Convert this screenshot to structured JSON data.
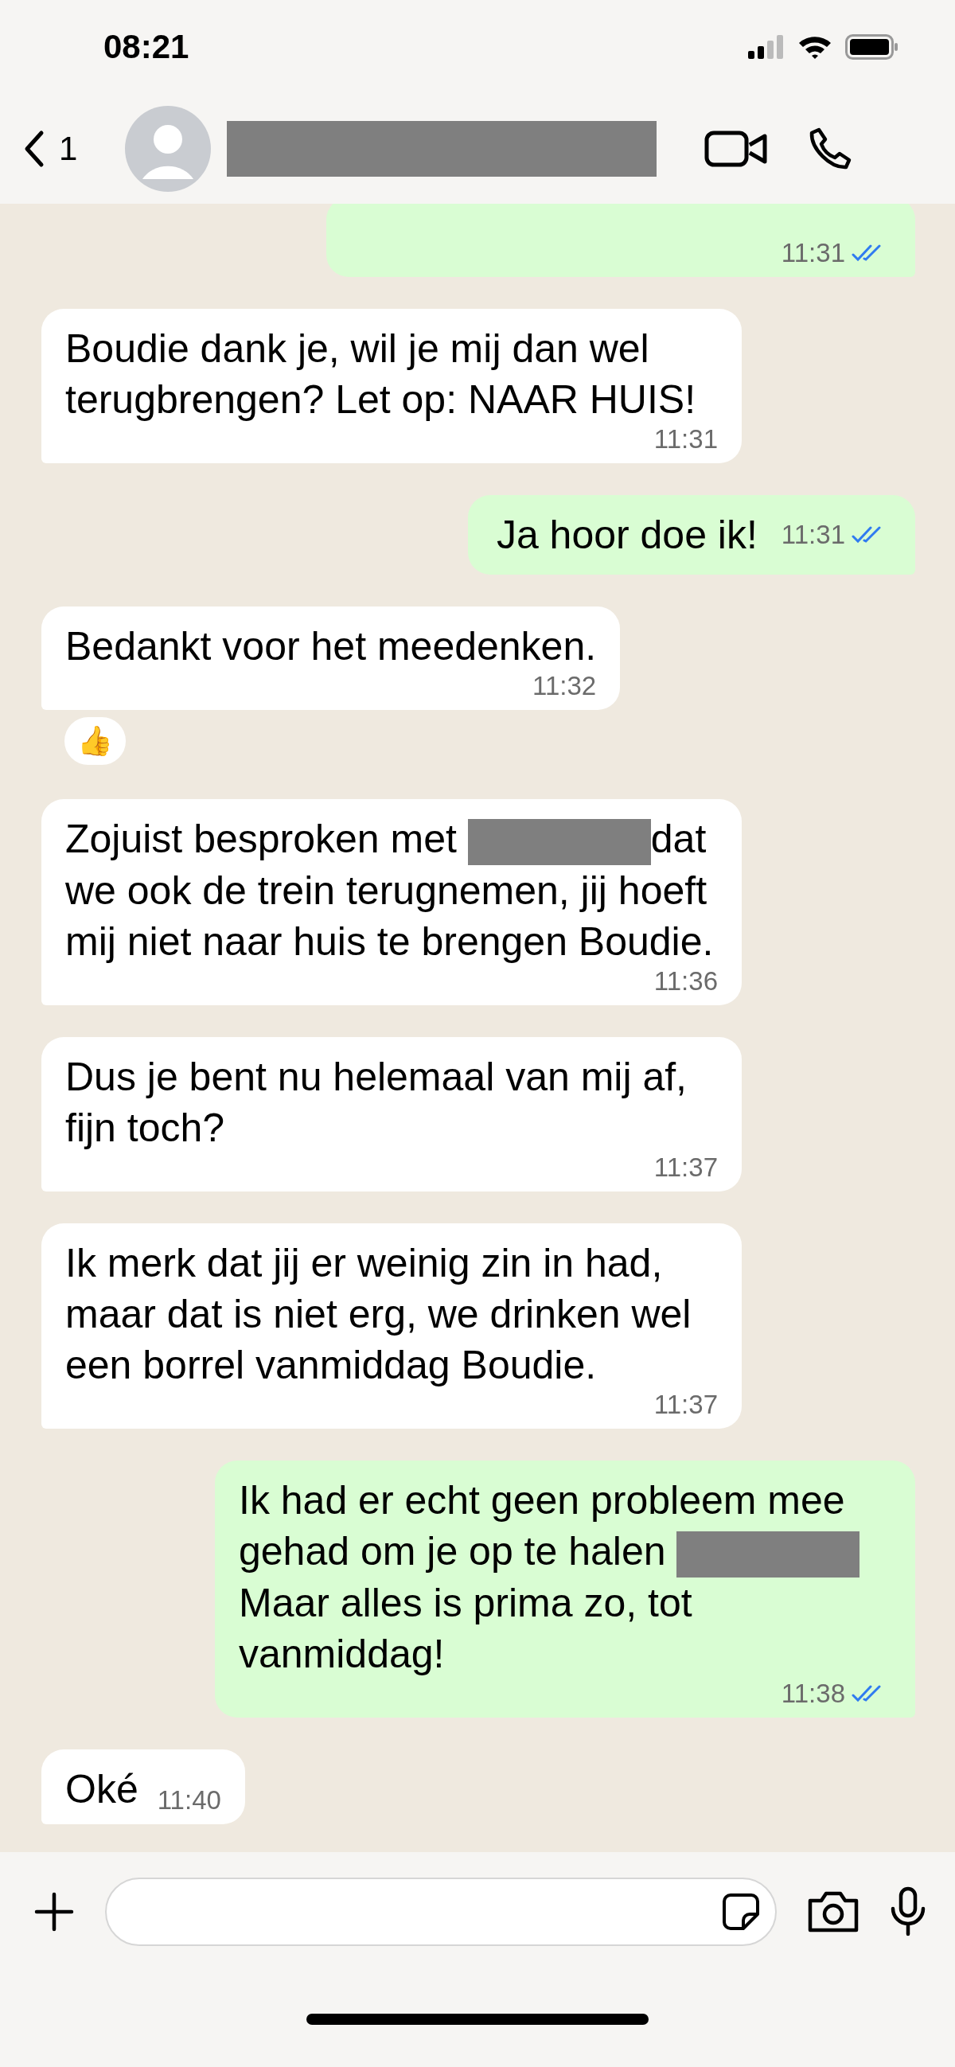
{
  "status_bar": {
    "time": "08:21"
  },
  "header": {
    "back_count": "1"
  },
  "messages": [
    {
      "kind": "out",
      "time": "11:31",
      "read": true
    },
    {
      "kind": "in",
      "time": "11:31",
      "parts": [
        {
          "kind": "text",
          "text": "Boudie dank je, wil je mij dan wel terugbrengen? Let op: NAAR HUIS!"
        }
      ]
    },
    {
      "kind": "out",
      "time": "11:31",
      "read": true,
      "parts": [
        {
          "kind": "text",
          "text": "Ja hoor doe ik!"
        }
      ]
    },
    {
      "kind": "in",
      "time": "11:32",
      "reaction": "👍",
      "parts": [
        {
          "kind": "text",
          "text": "Bedankt voor het meedenken."
        }
      ]
    },
    {
      "kind": "in",
      "time": "11:36",
      "parts": [
        {
          "kind": "text",
          "text": "Zojuist besproken met "
        },
        {
          "kind": "redacted"
        },
        {
          "kind": "text",
          "text": "dat we ook de trein terugnemen, jij hoeft mij niet naar huis te brengen Boudie."
        }
      ]
    },
    {
      "kind": "in",
      "time": "11:37",
      "parts": [
        {
          "kind": "text",
          "text": "Dus je bent nu helemaal van mij af, fijn toch?"
        }
      ]
    },
    {
      "kind": "in",
      "time": "11:37",
      "parts": [
        {
          "kind": "text",
          "text": "Ik merk dat jij er weinig zin in had, maar dat is niet erg, we drinken wel een borrel vanmiddag Boudie."
        }
      ]
    },
    {
      "kind": "out",
      "time": "11:38",
      "read": true,
      "parts": [
        {
          "kind": "text",
          "text": "Ik had er echt geen probleem mee gehad om je op te halen "
        },
        {
          "kind": "redacted"
        },
        {
          "kind": "text",
          "text": " Maar alles is prima zo, tot vanmiddag!"
        }
      ]
    },
    {
      "kind": "in_short",
      "time": "11:40",
      "parts": [
        {
          "kind": "text",
          "text": "Oké"
        }
      ]
    }
  ]
}
